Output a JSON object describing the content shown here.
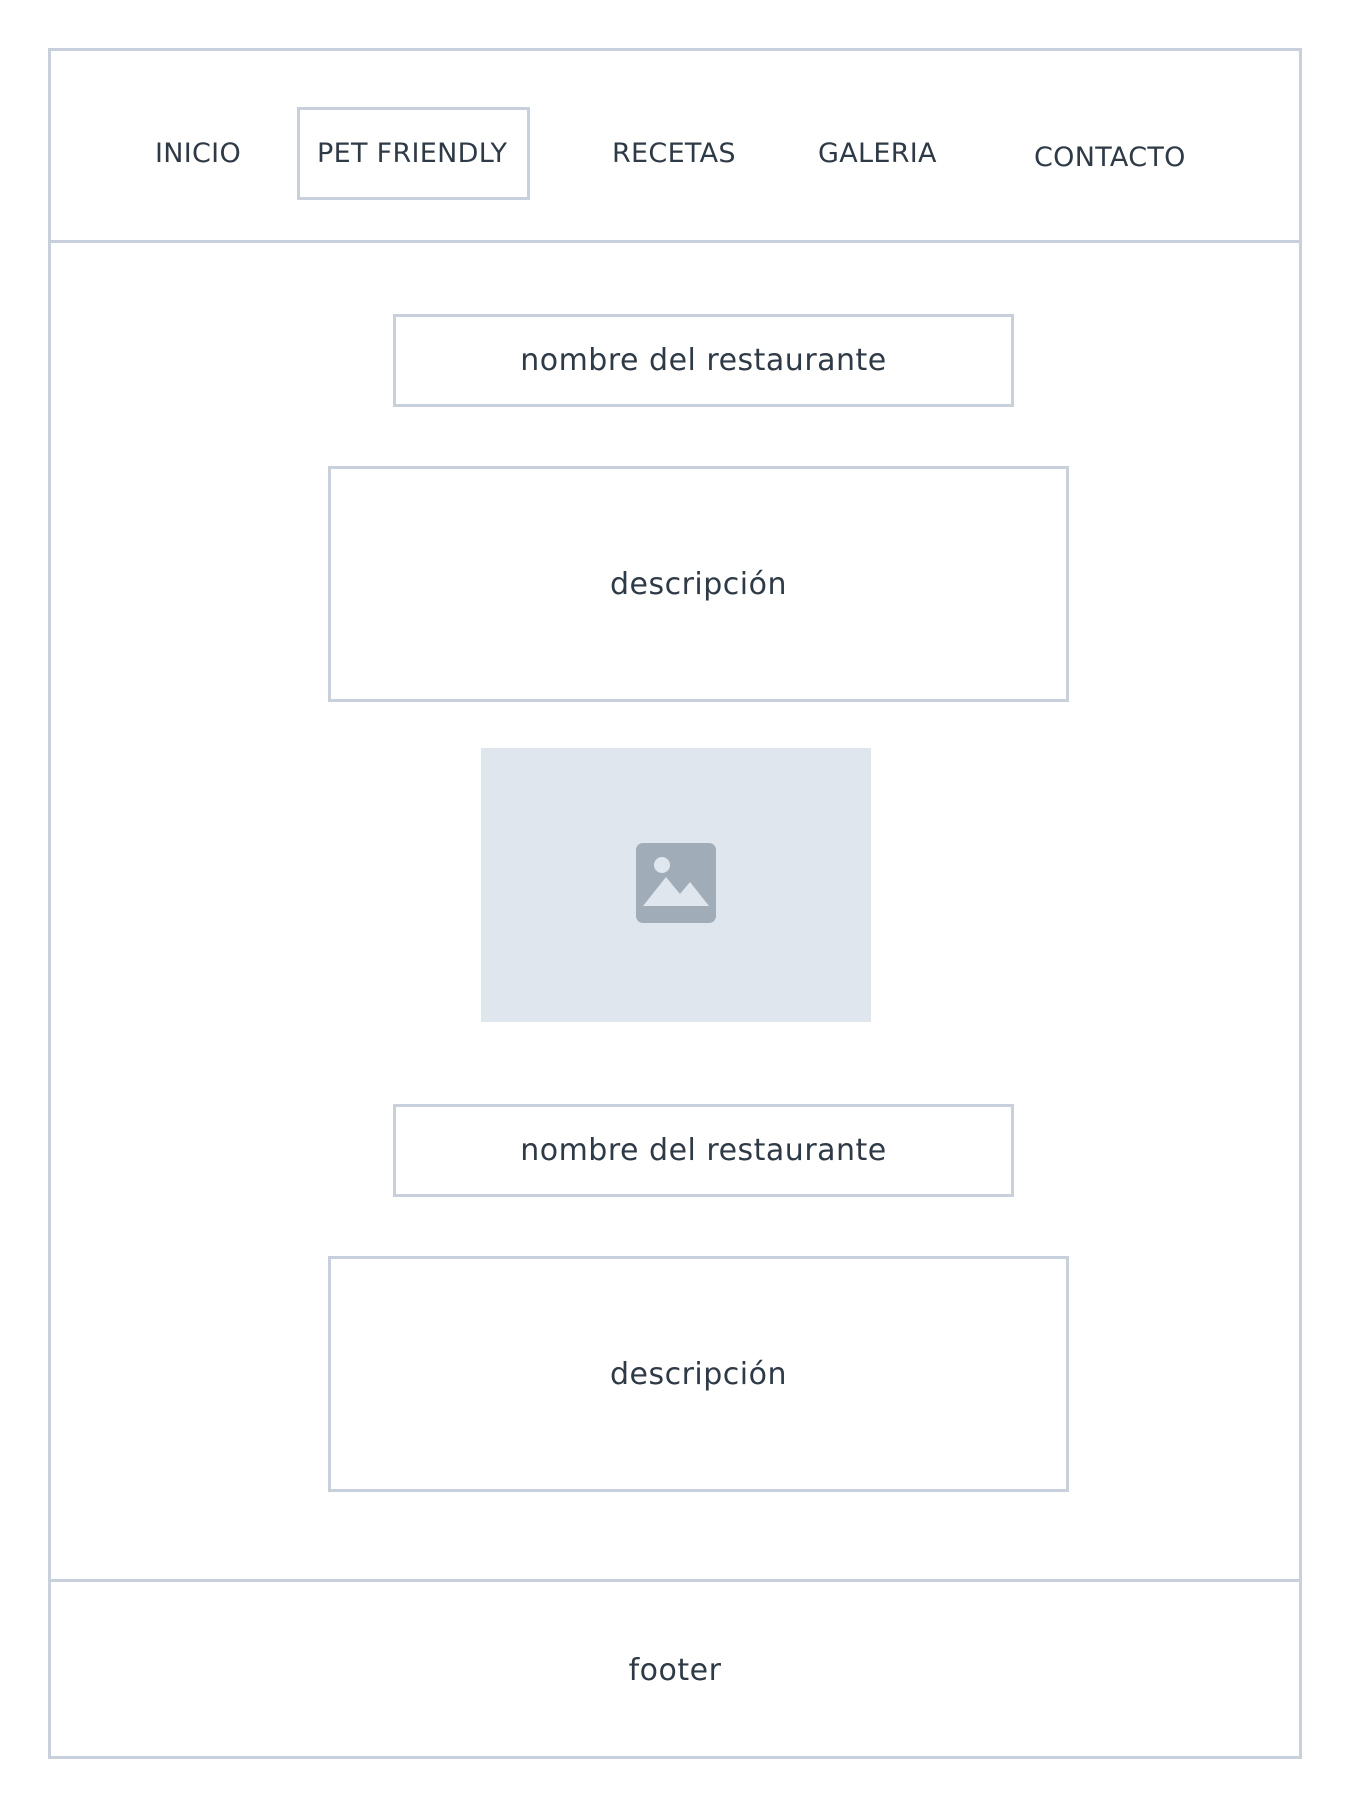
{
  "nav": {
    "items": [
      {
        "label": "INICIO"
      },
      {
        "label": "PET FRIENDLY",
        "active": true
      },
      {
        "label": "RECETAS"
      },
      {
        "label": "GALERIA"
      },
      {
        "label": "CONTACTO"
      }
    ]
  },
  "main": {
    "sections": [
      {
        "name_label": "nombre del restaurante",
        "description_label": "descripción"
      },
      {
        "name_label": "nombre del restaurante",
        "description_label": "descripción"
      }
    ],
    "image": {
      "icon": "image-icon"
    }
  },
  "footer": {
    "label": "footer"
  },
  "colors": {
    "border": "#c8d1db",
    "placeholder_bg": "#e0e6ee",
    "icon": "#a0adb8",
    "text": "#2f3a47"
  }
}
